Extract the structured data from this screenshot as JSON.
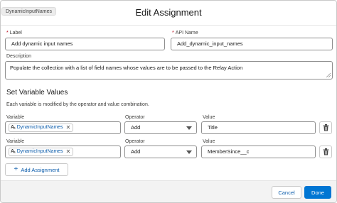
{
  "header": {
    "badge": "DynamicInputNames",
    "title": "Edit Assignment"
  },
  "form": {
    "label": {
      "required_mark": "*",
      "label": "Label",
      "value": "Add dynamic input names"
    },
    "api_name": {
      "required_mark": "*",
      "label": "API Name",
      "value": "Add_dynamic_input_names"
    },
    "description": {
      "label": "Description",
      "value": "Populate the collection with a list of field names whose values are to be passed to the Relay Action"
    }
  },
  "variables": {
    "title": "Set Variable Values",
    "description": "Each variable is modified by the operator and value combination.",
    "rows": [
      {
        "variable_label": "Variable",
        "variable_icon": "Aₐ",
        "variable_value": "DynamicInputNames",
        "operator_label": "Operator",
        "operator_value": "Add",
        "value_label": "Value",
        "value_value": "Title"
      },
      {
        "variable_label": "Variable",
        "variable_icon": "Aₐ",
        "variable_value": "DynamicInputNames",
        "operator_label": "Operator",
        "operator_value": "Add",
        "value_label": "Value",
        "value_value": "MemberSince__c"
      }
    ],
    "add_button": "Add Assignment"
  },
  "footer": {
    "cancel": "Cancel",
    "done": "Done"
  },
  "colors": {
    "brand": "#0176d3",
    "link": "#0b5cab",
    "required": "#ba0517"
  }
}
